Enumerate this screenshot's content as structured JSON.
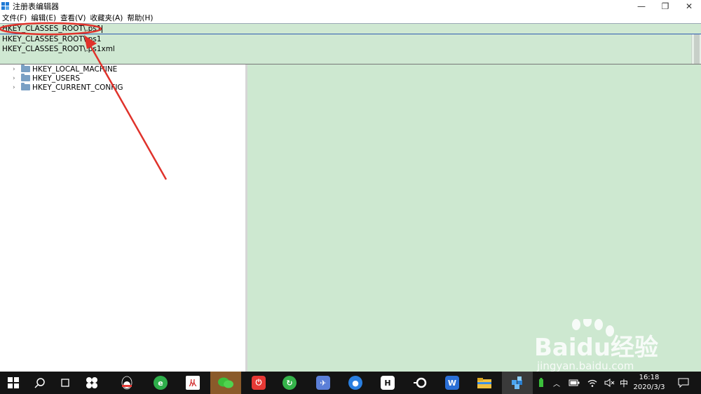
{
  "window": {
    "title": "注册表编辑器",
    "controls": {
      "minimize": "—",
      "restore": "❐",
      "close": "✕"
    }
  },
  "menu": [
    "文件(F)",
    "编辑(E)",
    "查看(V)",
    "收藏夹(A)",
    "帮助(H)"
  ],
  "address": {
    "value": "HKEY_CLASSES_ROOT\\.ps1"
  },
  "autocomplete": [
    "HKEY_CLASSES_ROOT\\.ps1",
    "HKEY_CLASSES_ROOT\\.ps1xml"
  ],
  "tree": [
    {
      "label": "HKEY_LOCAL_MACHINE",
      "icon": "folder-icon"
    },
    {
      "label": "HKEY_USERS",
      "icon": "folder-icon"
    },
    {
      "label": "HKEY_CURRENT_CONFIG",
      "icon": "folder-icon"
    }
  ],
  "colors": {
    "pane_bg": "#cde8d0",
    "annotation": "#e0322b",
    "taskbar": "#141414"
  },
  "taskbar": {
    "apps": [
      "windows-start-icon",
      "search-icon",
      "task-view-icon",
      "pinwheel-icon",
      "qq-icon",
      "ie-browser-icon",
      "red-app-icon",
      "wechat-icon",
      "power-app-icon",
      "refresh-app-icon",
      "bird-app-icon",
      "penguin-app-icon",
      "h-app-icon",
      "circle-app-icon",
      "wps-writer-icon",
      "file-explorer-icon",
      "regedit-icon"
    ],
    "tray": {
      "ime": "中",
      "time": "16:18",
      "date": "2020/3/3"
    }
  },
  "watermark": {
    "brand": "Baidu经验",
    "url": "jingyan.baidu.com"
  }
}
